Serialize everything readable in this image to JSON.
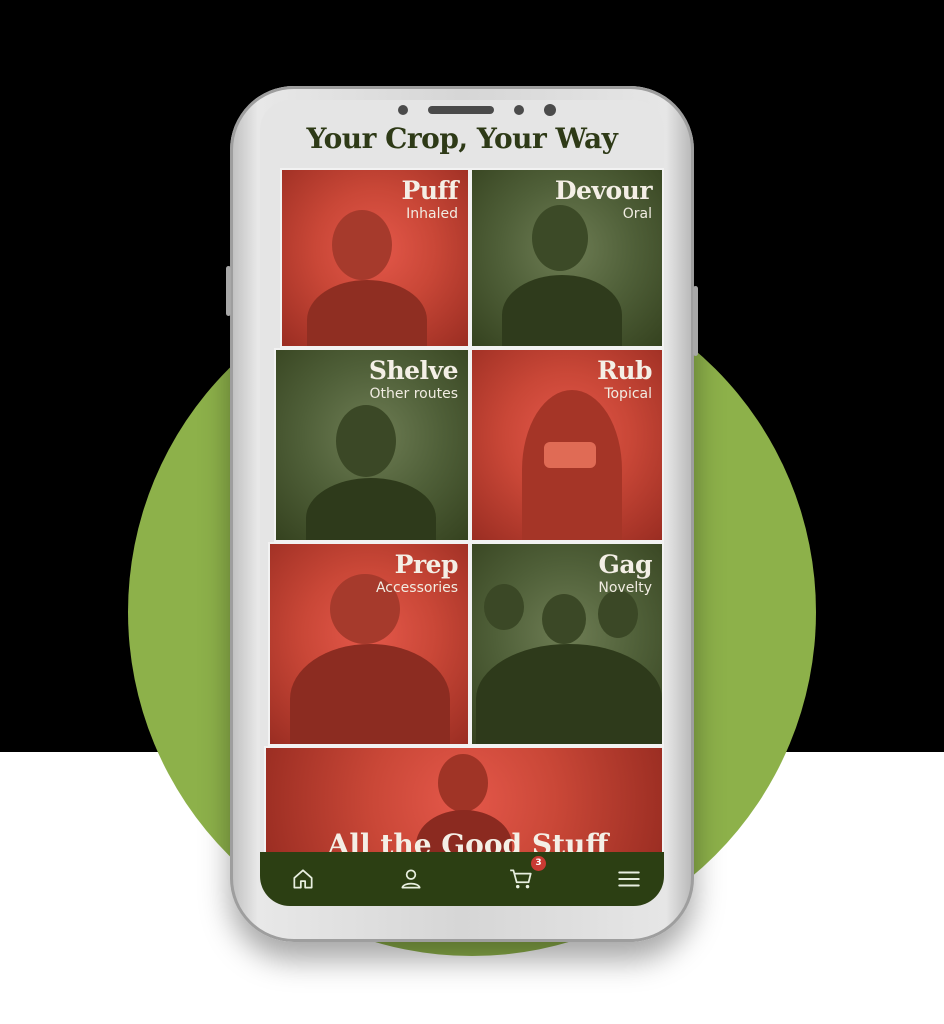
{
  "header": {
    "title": "Your Crop, Your Way"
  },
  "categories": [
    {
      "title": "Puff",
      "subtitle": "Inhaled",
      "theme": "red"
    },
    {
      "title": "Devour",
      "subtitle": "Oral",
      "theme": "green"
    },
    {
      "title": "Shelve",
      "subtitle": "Other routes",
      "theme": "green"
    },
    {
      "title": "Rub",
      "subtitle": "Topical",
      "theme": "red"
    },
    {
      "title": "Prep",
      "subtitle": "Accessories",
      "theme": "red"
    },
    {
      "title": "Gag",
      "subtitle": "Novelty",
      "theme": "green"
    }
  ],
  "banner": {
    "title": "All the Good Stuff"
  },
  "nav": {
    "items": [
      {
        "icon": "home-icon"
      },
      {
        "icon": "user-icon"
      },
      {
        "icon": "cart-icon",
        "badge": "3"
      },
      {
        "icon": "menu-icon"
      }
    ]
  },
  "colors": {
    "accent_red": "#c94737",
    "accent_green": "#4f5f38",
    "nav_bg": "#2c3f13",
    "halo": "#8db14a",
    "badge": "#c93a33"
  }
}
